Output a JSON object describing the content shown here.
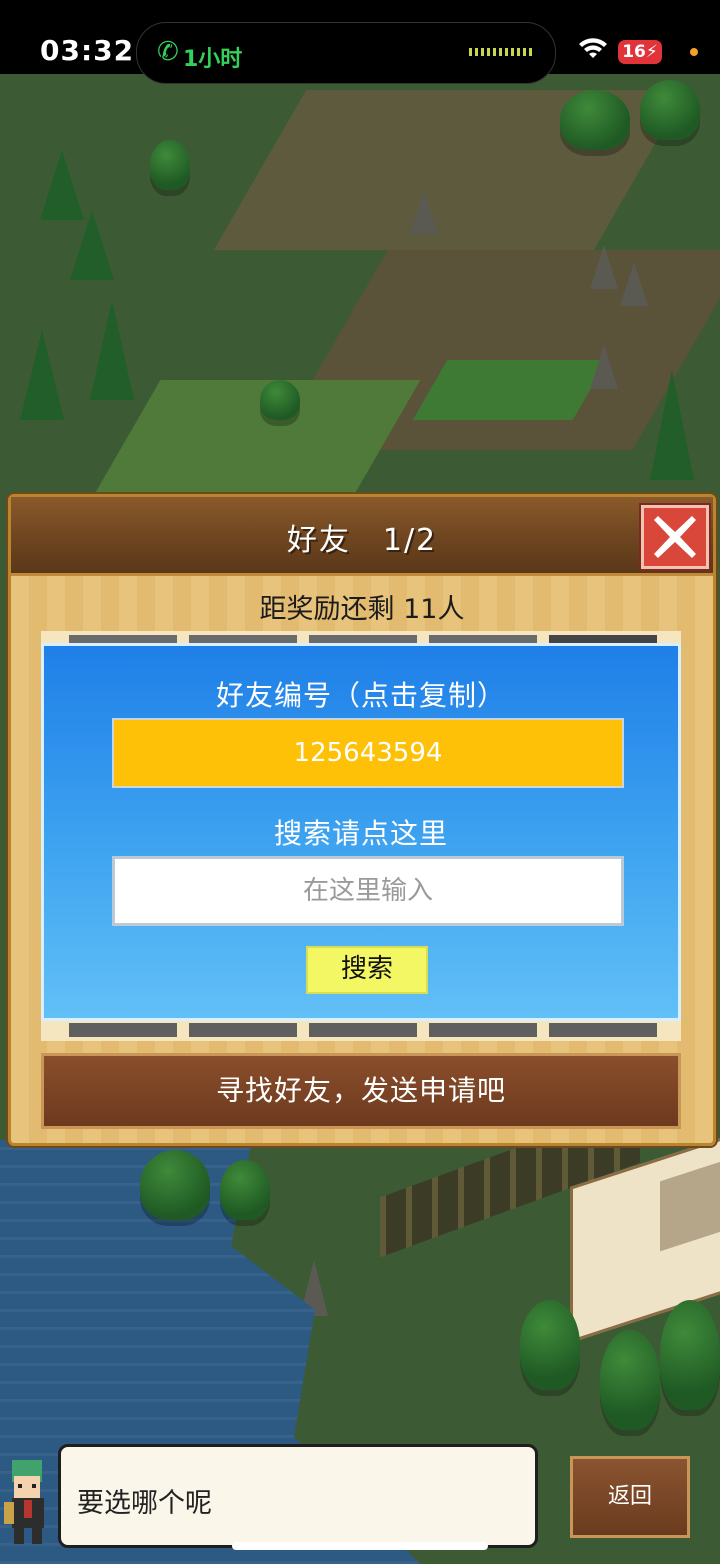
{
  "status_bar": {
    "time": "03:32",
    "call_text": "1小时",
    "battery": "16"
  },
  "friend_panel": {
    "title": "好友　1/2",
    "reward_text": "距奖励还剩 11人",
    "friend_id_label": "好友编号（点击复制）",
    "friend_id": "125643594",
    "search_label": "搜索请点这里",
    "search_placeholder": "在这里输入",
    "search_button": "搜索",
    "send_request_label": "寻找好友，发送申请吧"
  },
  "dialog": {
    "text": "要选哪个呢",
    "back_button": "返回"
  },
  "colors": {
    "accent_yellow": "#ffc107",
    "panel_wood": "#e8c37b",
    "panel_blue": "#3fa4f0",
    "close_red": "#d8473a"
  },
  "icons": [
    "phone-icon",
    "wifi-icon",
    "battery-icon",
    "close-icon",
    "arrow-left-icon",
    "arrow-right-icon"
  ]
}
